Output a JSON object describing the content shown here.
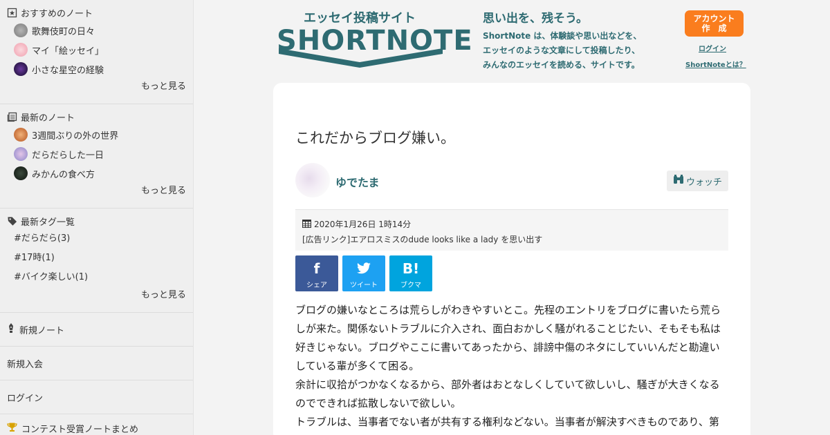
{
  "sidebar": {
    "recommended": {
      "heading": "おすすめのノート",
      "items": [
        {
          "label": "歌舞伎町の日々",
          "color": "#8a8a8a"
        },
        {
          "label": "マイ「絵ッセイ」",
          "color": "#f3b9c2"
        },
        {
          "label": "小さな星空の経験",
          "color": "#2b1f4a"
        }
      ],
      "more": "もっと見る"
    },
    "latest": {
      "heading": "最新のノート",
      "items": [
        {
          "label": "3週間ぶりの外の世界",
          "color": "#c9743a"
        },
        {
          "label": "だらだらした一日",
          "color": "#a9a2d6"
        },
        {
          "label": "みかんの食べ方",
          "color": "#1e2a22"
        }
      ],
      "more": "もっと見る"
    },
    "tags": {
      "heading": "最新タグ一覧",
      "items": [
        "#だらだら(3)",
        "#17時(1)",
        "#バイク楽しい(1)"
      ],
      "more": "もっと見る"
    },
    "new_note": "新規ノート",
    "signup": "新規入会",
    "login": "ログイン",
    "contest": "コンテスト受賞ノートまとめ"
  },
  "header": {
    "logo_sub": "エッセイ投稿サイト",
    "logo_main": "SHORTNOTE",
    "tagline_title": "思い出を、残そう。",
    "tagline_lines": [
      "ShortNote は、体験談や思い出などを、",
      "エッセイのような文章にして投稿したり、",
      "みんなのエッセイを読める、サイトです。"
    ],
    "account_line1": "アカウント",
    "account_line2": "作　成",
    "login_link": "ログイン",
    "about_link": "ShortNoteとは？",
    "accent": "#2e6b72",
    "button_color": "#fa7d1e"
  },
  "article": {
    "title": "これだからブログ嫌い。",
    "author": "ゆでたま",
    "watch_label": "ウォッチ",
    "date": "2020年1月26日 1時14分",
    "ad": "[広告リンク]エアロスミスのdude looks like a lady を思い出す",
    "share": [
      {
        "glyph": "f",
        "label": "シェア",
        "color": "#3b5998"
      },
      {
        "glyph": "t",
        "label": "ツイート",
        "color": "#1da1f2"
      },
      {
        "glyph": "B!",
        "label": "ブクマ",
        "color": "#00a4de"
      }
    ],
    "paragraphs": [
      " ブログの嫌いなところは荒らしがわきやすいとこ。先程のエントリをブログに書いたら荒らしが来た。関係ないトラブルに介入され、面白おかしく騒がれることじたい、そもそも私は好きじゃない。ブログやここに書いてあったから、誹謗中傷のネタにしていいんだと勘違いしている輩が多くて困る。",
      "余計に収拾がつかなくなるから、部外者はおとなしくしていて欲しいし、騒ぎが大きくなるのでできれば拡散しないで欲しい。",
      " トラブルは、当事者でない者が共有する権利などない。当事者が解決すべきものであり、第"
    ]
  }
}
